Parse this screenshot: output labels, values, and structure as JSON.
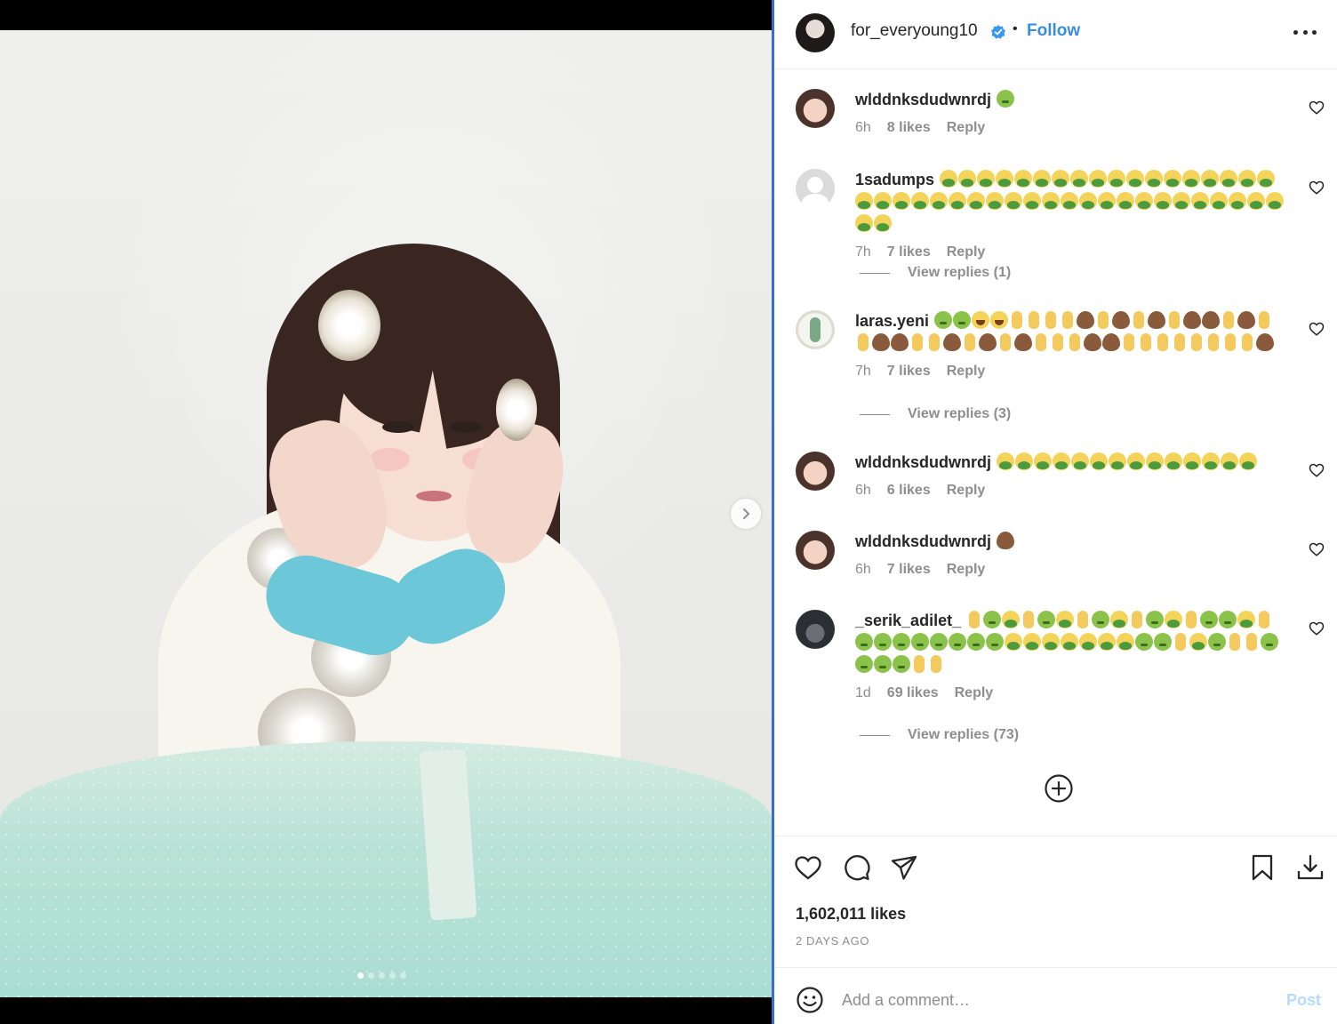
{
  "post": {
    "username": "for_everyoung10",
    "separator": "•",
    "follow_label": "Follow",
    "likes_total": "1,602,011 likes",
    "date": "2 DAYS AGO",
    "carousel": {
      "slide_count": 5,
      "active_slide": 1
    }
  },
  "comments": [
    {
      "username": "wlddnksdudwnrdj",
      "emojis": [
        "sick-face"
      ],
      "time": "6h",
      "likes": "8 likes",
      "reply_label": "Reply"
    },
    {
      "username": "1sadumps",
      "emojis": [
        "vomit",
        "vomit",
        "vomit",
        "vomit",
        "vomit",
        "vomit",
        "vomit",
        "vomit",
        "vomit",
        "vomit",
        "vomit",
        "vomit",
        "vomit",
        "vomit",
        "vomit",
        "vomit",
        "vomit",
        "vomit",
        "vomit",
        "vomit",
        "vomit",
        "vomit",
        "vomit",
        "vomit",
        "vomit",
        "vomit",
        "vomit",
        "vomit",
        "vomit",
        "vomit",
        "vomit",
        "vomit",
        "vomit",
        "vomit",
        "vomit",
        "vomit",
        "vomit",
        "vomit",
        "vomit",
        "vomit",
        "vomit",
        "vomit",
        "vomit"
      ],
      "time": "7h",
      "likes": "7 likes",
      "reply_label": "Reply",
      "view_replies": "View replies (1)"
    },
    {
      "username": "laras.yeni",
      "emojis": [
        "sick-face",
        "sick-face",
        "joy",
        "joy",
        "finger",
        "finger",
        "finger",
        "finger",
        "poo",
        "finger",
        "poo",
        "finger",
        "poo",
        "finger",
        "poo",
        "poo",
        "finger",
        "poo",
        "finger",
        "finger",
        "poo",
        "poo",
        "finger",
        "finger",
        "poo",
        "finger",
        "poo",
        "finger",
        "poo",
        "finger",
        "finger",
        "finger",
        "poo",
        "poo",
        "finger",
        "finger",
        "finger",
        "finger",
        "finger",
        "finger",
        "finger",
        "finger",
        "poo"
      ],
      "time": "7h",
      "likes": "7 likes",
      "reply_label": "Reply",
      "view_replies": "View replies (3)"
    },
    {
      "username": "wlddnksdudwnrdj",
      "emojis": [
        "vomit",
        "vomit",
        "vomit",
        "vomit",
        "vomit",
        "vomit",
        "vomit",
        "vomit",
        "vomit",
        "vomit",
        "vomit",
        "vomit",
        "vomit",
        "vomit"
      ],
      "time": "6h",
      "likes": "6 likes",
      "reply_label": "Reply"
    },
    {
      "username": "wlddnksdudwnrdj",
      "emojis": [
        "poo"
      ],
      "time": "6h",
      "likes": "7 likes",
      "reply_label": "Reply"
    },
    {
      "username": "_serik_adilet_",
      "emojis": [
        "finger",
        "sick-face",
        "vomit",
        "finger",
        "sick-face",
        "vomit",
        "finger",
        "sick-face",
        "vomit",
        "finger",
        "sick-face",
        "vomit",
        "finger",
        "sick-face",
        "sick-face",
        "vomit",
        "finger",
        "sick-face",
        "sick-face",
        "sick-face",
        "sick-face",
        "sick-face",
        "sick-face",
        "sick-face",
        "sick-face",
        "vomit",
        "vomit",
        "vomit",
        "vomit",
        "vomit",
        "vomit",
        "vomit",
        "sick-face",
        "sick-face",
        "finger",
        "vomit",
        "sick-face",
        "finger",
        "finger",
        "sick-face",
        "sick-face",
        "sick-face",
        "sick-face",
        "finger",
        "finger"
      ],
      "time": "1d",
      "likes": "69 likes",
      "reply_label": "Reply",
      "view_replies": "View replies (73)"
    }
  ],
  "add_comment": {
    "placeholder": "Add a comment…",
    "post_label": "Post"
  },
  "icons": {
    "verified": "verified-badge-icon",
    "more": "more-options-icon",
    "like": "heart-icon",
    "comment": "comment-icon",
    "share": "send-icon",
    "save": "bookmark-icon",
    "download": "download-icon",
    "emoji": "emoji-icon",
    "load_more": "plus-circle-icon",
    "next": "chevron-right-icon"
  },
  "colors": {
    "link_blue": "#3a8dde",
    "post_disabled": "#b3dbff",
    "panel_border": "#3a6cd6"
  }
}
